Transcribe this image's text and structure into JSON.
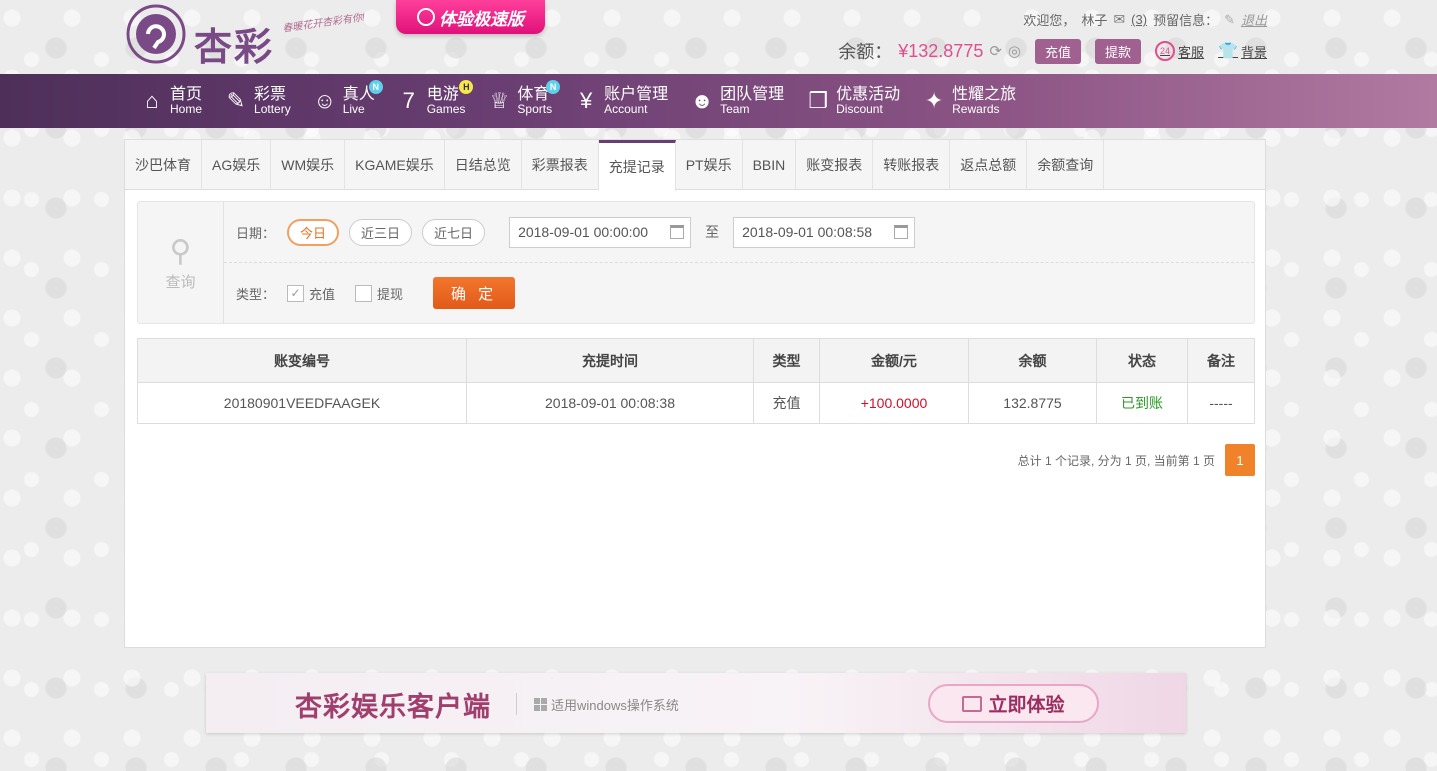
{
  "header": {
    "logo_text": "杏彩",
    "slogan": "春暖花开杏彩有你!",
    "speed_label": "体验极速版",
    "welcome_prefix": "欢迎您，",
    "username": "林子",
    "mail_count": "(3)",
    "reserve_info": "预留信息：",
    "logout": "退出",
    "balance_label": "余额：",
    "balance_value": "¥132.8775",
    "deposit": "充值",
    "withdraw": "提款",
    "service": "客服",
    "background": "背景"
  },
  "nav": [
    {
      "cn": "首页",
      "en": "Home",
      "icon": "home-icon",
      "badge": ""
    },
    {
      "cn": "彩票",
      "en": "Lottery",
      "icon": "ticket-icon",
      "badge": ""
    },
    {
      "cn": "真人",
      "en": "Live",
      "icon": "person-icon",
      "badge": "N"
    },
    {
      "cn": "电游",
      "en": "Games",
      "icon": "slot-7-icon",
      "badge": "H"
    },
    {
      "cn": "体育",
      "en": "Sports",
      "icon": "trophy-icon",
      "badge": "N"
    },
    {
      "cn": "账户管理",
      "en": "Account",
      "icon": "yen-icon",
      "badge": ""
    },
    {
      "cn": "团队管理",
      "en": "Team",
      "icon": "team-icon",
      "badge": ""
    },
    {
      "cn": "优惠活动",
      "en": "Discount",
      "icon": "gift-icon",
      "badge": ""
    },
    {
      "cn": "性耀之旅",
      "en": "Rewards",
      "icon": "rewards-icon",
      "badge": ""
    }
  ],
  "tabs": [
    "沙巴体育",
    "AG娱乐",
    "WM娱乐",
    "KGAME娱乐",
    "日结总览",
    "彩票报表",
    "充提记录",
    "PT娱乐",
    "BBIN",
    "账变报表",
    "转账报表",
    "返点总额",
    "余额查询"
  ],
  "active_tab": "充提记录",
  "query": {
    "side_label": "查询",
    "date_label": "日期：",
    "quick_today": "今日",
    "quick_3": "近三日",
    "quick_7": "近七日",
    "start": "2018-09-01 00:00:00",
    "to": "至",
    "end": "2018-09-01 00:08:58",
    "type_label": "类型：",
    "type_deposit": "充值",
    "type_withdraw": "提现",
    "deposit_checked": true,
    "withdraw_checked": false,
    "confirm": "确 定"
  },
  "table": {
    "headers": [
      "账变编号",
      "充提时间",
      "类型",
      "金额/元",
      "余额",
      "状态",
      "备注"
    ],
    "rows": [
      [
        "20180901VEEDFAAGEK",
        "2018-09-01 00:08:38",
        "充值",
        "+100.0000",
        "132.8775",
        "已到账",
        "-----"
      ]
    ]
  },
  "pager": {
    "summary": "总计 1 个记录, 分为 1 页, 当前第 1 页",
    "page": "1"
  },
  "banner": {
    "title": "杏彩娱乐客户端",
    "sub": "适用windows操作系统",
    "button": "立即体验"
  },
  "colors": {
    "accent": "#6a3e72",
    "orange": "#e8721e",
    "pink": "#e04e8e"
  }
}
